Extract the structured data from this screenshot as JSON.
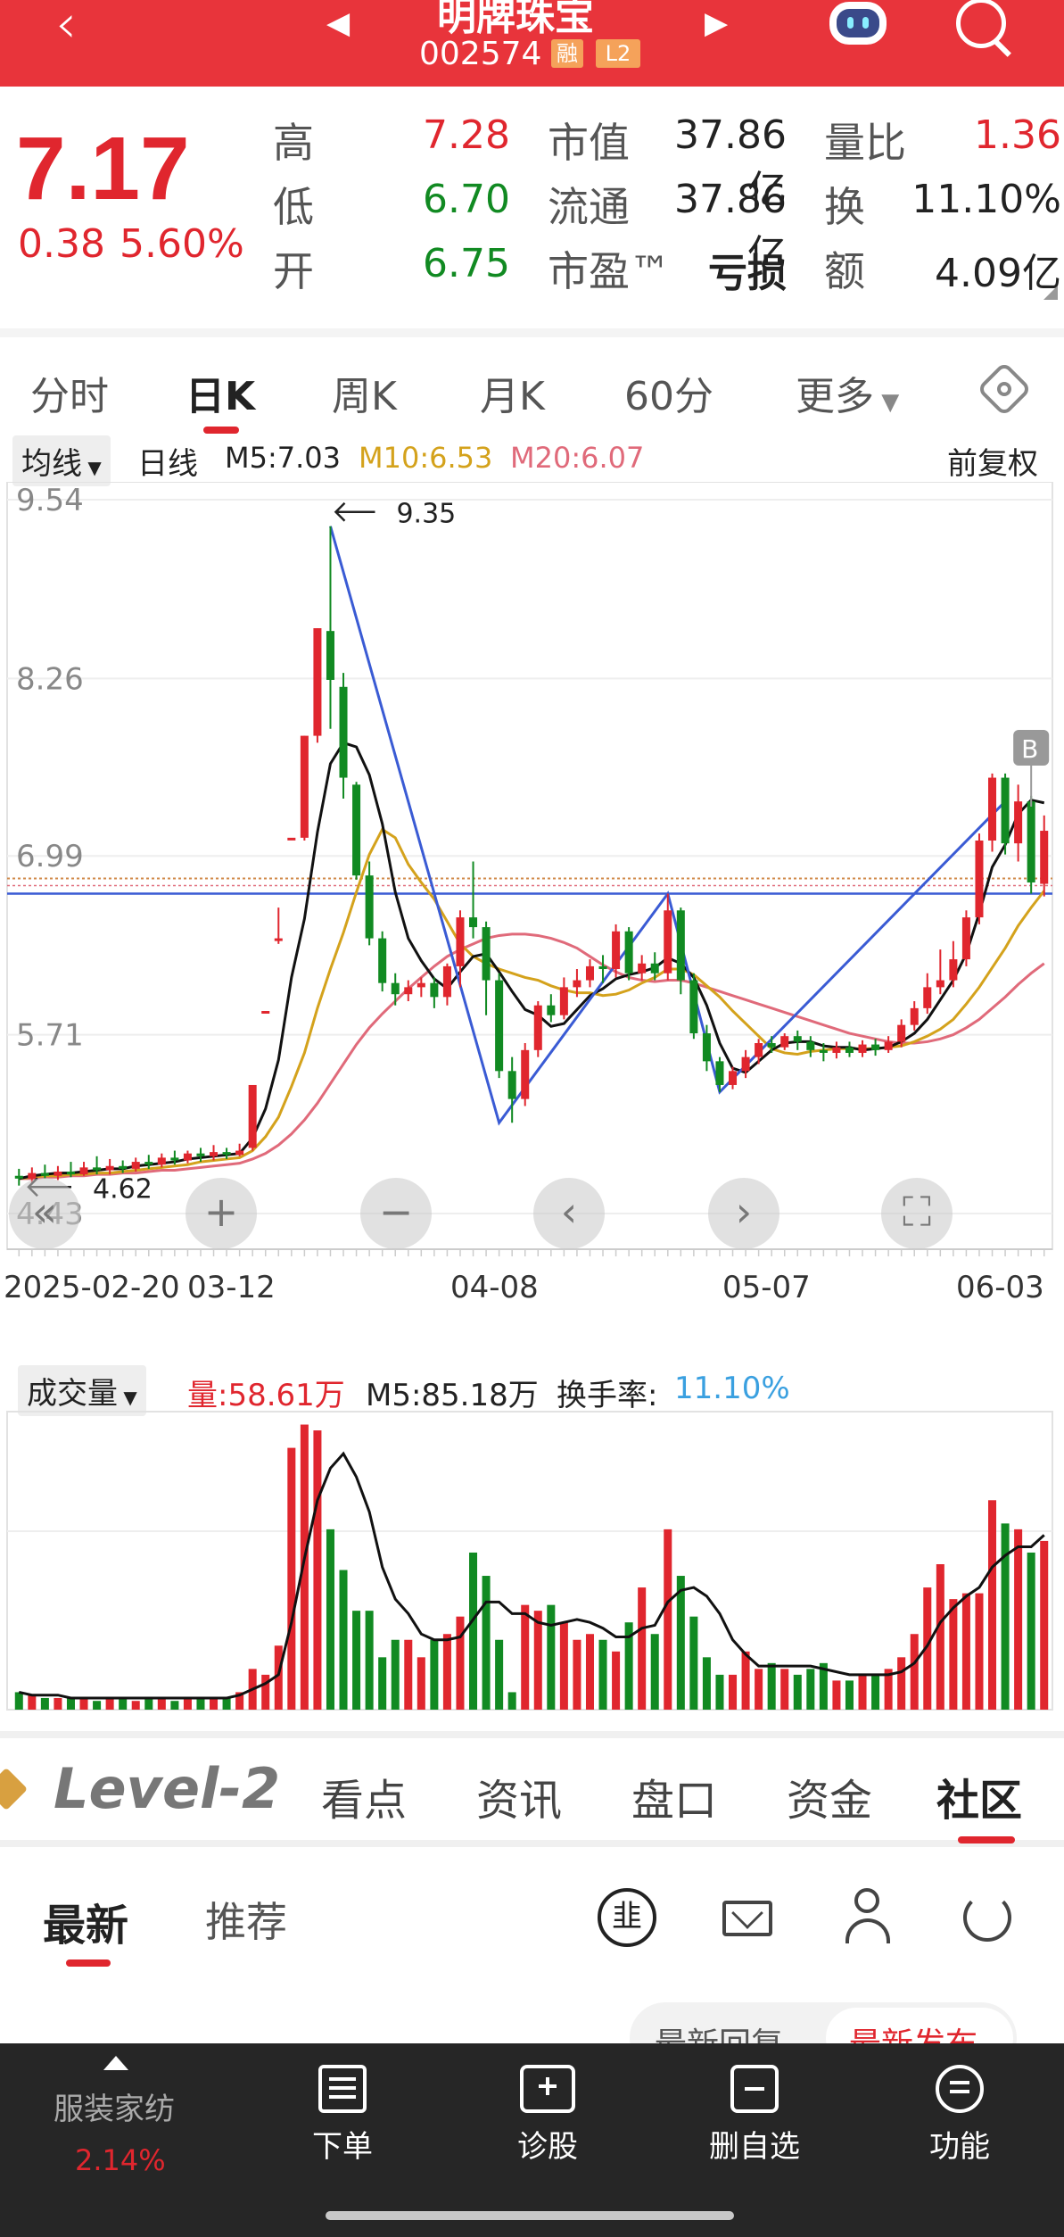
{
  "header": {
    "stock_name": "明牌珠宝",
    "stock_code": "002574",
    "badge_margin": "融",
    "badge_level": "L2"
  },
  "quote": {
    "price": "7.17",
    "change": "0.38",
    "change_pct": "5.60%",
    "rows": [
      {
        "l1": "高",
        "v1": "7.28",
        "l2": "市值",
        "v2": "37.86亿",
        "l3": "量比",
        "v3": "1.36"
      },
      {
        "l1": "低",
        "v1": "6.70",
        "l2": "流通",
        "v2": "37.86亿",
        "l3": "换",
        "v3": "11.10%"
      },
      {
        "l1": "开",
        "v1": "6.75",
        "l2": "市盈™",
        "v2": "亏损",
        "l3": "额",
        "v3": "4.09亿"
      }
    ]
  },
  "tabs": [
    "分时",
    "日K",
    "周K",
    "月K",
    "60分",
    "更多"
  ],
  "ma_legend": {
    "selector": "均线",
    "period": "日线",
    "m5": "M5:7.03",
    "m10": "M10:6.53",
    "m20": "M20:6.07",
    "adjust": "前复权"
  },
  "colors": {
    "up": "#e0262e",
    "down": "#118a22",
    "m5": "#111111",
    "m10": "#d4a21c",
    "m20": "#e06a7a",
    "trend": "#3a5bd4"
  },
  "chart_data": {
    "type": "candlestick",
    "y_ticks": [
      "9.54",
      "8.26",
      "6.99",
      "5.71",
      "4.43"
    ],
    "ylim": [
      4.43,
      9.54
    ],
    "x_ticks": [
      "2025-02-20",
      "03-12",
      "04-08",
      "05-07",
      "06-03"
    ],
    "max_label": "9.35",
    "min_label": "4.62",
    "b_marker": "B",
    "candles": [
      [
        4.7,
        4.68,
        4.75,
        4.63
      ],
      [
        4.68,
        4.72,
        4.76,
        4.65
      ],
      [
        4.72,
        4.7,
        4.78,
        4.68
      ],
      [
        4.7,
        4.73,
        4.77,
        4.67
      ],
      [
        4.73,
        4.71,
        4.8,
        4.69
      ],
      [
        4.71,
        4.76,
        4.8,
        4.7
      ],
      [
        4.76,
        4.74,
        4.84,
        4.71
      ],
      [
        4.74,
        4.77,
        4.82,
        4.71
      ],
      [
        4.77,
        4.75,
        4.81,
        4.72
      ],
      [
        4.75,
        4.8,
        4.83,
        4.73
      ],
      [
        4.8,
        4.78,
        4.85,
        4.75
      ],
      [
        4.78,
        4.83,
        4.86,
        4.76
      ],
      [
        4.83,
        4.81,
        4.88,
        4.78
      ],
      [
        4.81,
        4.86,
        4.88,
        4.79
      ],
      [
        4.86,
        4.84,
        4.9,
        4.8
      ],
      [
        4.84,
        4.87,
        4.92,
        4.81
      ],
      [
        4.87,
        4.85,
        4.9,
        4.82
      ],
      [
        4.85,
        4.88,
        4.93,
        4.84
      ],
      [
        4.9,
        5.35,
        5.35,
        4.88
      ],
      [
        5.88,
        5.88,
        5.88,
        5.88
      ],
      [
        6.4,
        6.4,
        6.62,
        6.36
      ],
      [
        7.12,
        7.12,
        7.12,
        7.12
      ],
      [
        7.12,
        7.85,
        7.85,
        7.1
      ],
      [
        7.85,
        8.62,
        8.62,
        7.8
      ],
      [
        8.6,
        8.25,
        9.35,
        7.9
      ],
      [
        8.2,
        7.55,
        8.3,
        7.4
      ],
      [
        7.5,
        6.85,
        7.52,
        6.82
      ],
      [
        6.85,
        6.4,
        6.95,
        6.35
      ],
      [
        6.4,
        6.08,
        6.45,
        6.02
      ],
      [
        6.08,
        6.0,
        6.15,
        5.92
      ],
      [
        6.0,
        6.05,
        6.1,
        5.95
      ],
      [
        6.05,
        6.08,
        6.12,
        5.98
      ],
      [
        6.08,
        5.98,
        6.12,
        5.9
      ],
      [
        5.98,
        6.2,
        6.22,
        5.92
      ],
      [
        6.2,
        6.55,
        6.6,
        6.05
      ],
      [
        6.55,
        6.48,
        6.95,
        6.4
      ],
      [
        6.48,
        6.1,
        6.52,
        5.85
      ],
      [
        6.1,
        5.45,
        6.15,
        5.4
      ],
      [
        5.45,
        5.25,
        5.55,
        5.08
      ],
      [
        5.25,
        5.6,
        5.65,
        5.2
      ],
      [
        5.6,
        5.92,
        5.95,
        5.55
      ],
      [
        5.92,
        5.85,
        6.0,
        5.8
      ],
      [
        5.85,
        6.05,
        6.12,
        5.82
      ],
      [
        6.05,
        6.1,
        6.18,
        5.98
      ],
      [
        6.1,
        6.2,
        6.25,
        6.05
      ],
      [
        6.2,
        6.18,
        6.28,
        6.08
      ],
      [
        6.18,
        6.45,
        6.5,
        6.12
      ],
      [
        6.45,
        6.15,
        6.48,
        6.1
      ],
      [
        6.15,
        6.22,
        6.28,
        6.1
      ],
      [
        6.22,
        6.15,
        6.3,
        6.1
      ],
      [
        6.15,
        6.6,
        6.72,
        6.1
      ],
      [
        6.6,
        6.1,
        6.62,
        6.0
      ],
      [
        6.1,
        5.72,
        6.15,
        5.68
      ],
      [
        5.72,
        5.52,
        5.78,
        5.45
      ],
      [
        5.52,
        5.35,
        5.55,
        5.3
      ],
      [
        5.35,
        5.45,
        5.48,
        5.32
      ],
      [
        5.45,
        5.55,
        5.6,
        5.4
      ],
      [
        5.55,
        5.65,
        5.68,
        5.5
      ],
      [
        5.65,
        5.62,
        5.7,
        5.58
      ],
      [
        5.62,
        5.7,
        5.72,
        5.6
      ],
      [
        5.7,
        5.66,
        5.74,
        5.6
      ],
      [
        5.66,
        5.6,
        5.7,
        5.55
      ],
      [
        5.6,
        5.58,
        5.65,
        5.52
      ],
      [
        5.58,
        5.62,
        5.66,
        5.54
      ],
      [
        5.62,
        5.58,
        5.66,
        5.55
      ],
      [
        5.58,
        5.64,
        5.67,
        5.55
      ],
      [
        5.64,
        5.6,
        5.68,
        5.56
      ],
      [
        5.6,
        5.66,
        5.7,
        5.58
      ],
      [
        5.66,
        5.78,
        5.82,
        5.62
      ],
      [
        5.78,
        5.9,
        5.95,
        5.74
      ],
      [
        5.9,
        6.05,
        6.15,
        5.86
      ],
      [
        6.05,
        6.1,
        6.32,
        6.0
      ],
      [
        6.1,
        6.25,
        6.38,
        6.05
      ],
      [
        6.25,
        6.55,
        6.6,
        6.2
      ],
      [
        6.55,
        7.1,
        7.15,
        6.5
      ],
      [
        7.1,
        7.55,
        7.58,
        7.02
      ],
      [
        7.55,
        7.08,
        7.58,
        7.0
      ],
      [
        7.08,
        7.38,
        7.5,
        6.95
      ],
      [
        7.38,
        6.8,
        7.42,
        6.72
      ],
      [
        6.79,
        7.17,
        7.28,
        6.7
      ]
    ],
    "m5": [
      4.68,
      4.7,
      4.71,
      4.72,
      4.72,
      4.73,
      4.74,
      4.75,
      4.75,
      4.77,
      4.78,
      4.79,
      4.8,
      4.82,
      4.83,
      4.84,
      4.85,
      4.86,
      4.97,
      5.18,
      5.53,
      6.12,
      6.54,
      7.16,
      7.65,
      7.8,
      7.77,
      7.57,
      7.22,
      6.73,
      6.4,
      6.24,
      6.11,
      6.04,
      6.16,
      6.27,
      6.29,
      6.16,
      6.02,
      5.89,
      5.85,
      5.77,
      5.79,
      5.89,
      5.99,
      6.04,
      6.11,
      6.14,
      6.16,
      6.19,
      6.26,
      6.22,
      6.12,
      5.92,
      5.65,
      5.47,
      5.44,
      5.52,
      5.6,
      5.65,
      5.66,
      5.66,
      5.63,
      5.62,
      5.62,
      5.6,
      5.61,
      5.62,
      5.66,
      5.72,
      5.82,
      5.96,
      6.1,
      6.29,
      6.58,
      6.91,
      7.07,
      7.29,
      7.39,
      7.37
    ],
    "m10": [
      4.68,
      4.69,
      4.7,
      4.7,
      4.71,
      4.71,
      4.72,
      4.72,
      4.73,
      4.74,
      4.75,
      4.76,
      4.77,
      4.78,
      4.8,
      4.81,
      4.82,
      4.83,
      4.88,
      4.98,
      5.12,
      5.34,
      5.58,
      5.9,
      6.18,
      6.44,
      6.73,
      7.0,
      7.18,
      7.12,
      6.93,
      6.8,
      6.68,
      6.52,
      6.36,
      6.27,
      6.22,
      6.18,
      6.15,
      6.12,
      6.1,
      6.06,
      6.03,
      6.01,
      6.01,
      5.99,
      6.0,
      6.03,
      6.08,
      6.12,
      6.18,
      6.18,
      6.14,
      6.06,
      5.98,
      5.88,
      5.79,
      5.7,
      5.61,
      5.58,
      5.57,
      5.59,
      5.6,
      5.61,
      5.61,
      5.61,
      5.61,
      5.62,
      5.63,
      5.66,
      5.7,
      5.75,
      5.82,
      5.93,
      6.05,
      6.19,
      6.33,
      6.49,
      6.62,
      6.74
    ],
    "m20": [
      4.68,
      4.68,
      4.69,
      4.69,
      4.7,
      4.7,
      4.71,
      4.71,
      4.72,
      4.72,
      4.73,
      4.74,
      4.74,
      4.75,
      4.76,
      4.77,
      4.78,
      4.79,
      4.82,
      4.86,
      4.92,
      5.0,
      5.1,
      5.22,
      5.36,
      5.5,
      5.64,
      5.76,
      5.86,
      5.95,
      6.04,
      6.12,
      6.2,
      6.27,
      6.32,
      6.36,
      6.4,
      6.42,
      6.43,
      6.43,
      6.42,
      6.4,
      6.37,
      6.33,
      6.27,
      6.21,
      6.16,
      6.12,
      6.1,
      6.09,
      6.1,
      6.1,
      6.08,
      6.05,
      6.02,
      5.99,
      5.96,
      5.93,
      5.9,
      5.87,
      5.84,
      5.81,
      5.78,
      5.75,
      5.72,
      5.7,
      5.68,
      5.66,
      5.65,
      5.65,
      5.66,
      5.68,
      5.71,
      5.76,
      5.82,
      5.9,
      5.98,
      6.07,
      6.15,
      6.22
    ],
    "trend_points": [
      [
        24,
        9.35
      ],
      [
        37,
        5.08
      ],
      [
        50,
        6.72
      ],
      [
        54,
        5.3
      ],
      [
        76,
        7.38
      ]
    ],
    "ref_line": 6.72,
    "prev_close_line": 6.79
  },
  "volume": {
    "selector": "成交量",
    "vol_label": "量:58.61万",
    "m5_label": "M5:85.18万",
    "turnover_label": "换手率:",
    "turnover_value": "11.10%",
    "bars": [
      6,
      5,
      4,
      4,
      4,
      4,
      3,
      4,
      4,
      3,
      4,
      4,
      3,
      4,
      4,
      4,
      4,
      6,
      14,
      12,
      22,
      90,
      98,
      96,
      62,
      48,
      34,
      34,
      18,
      24,
      24,
      18,
      24,
      26,
      32,
      54,
      46,
      24,
      6,
      36,
      34,
      36,
      30,
      24,
      26,
      24,
      20,
      30,
      42,
      26,
      62,
      46,
      32,
      18,
      12,
      12,
      20,
      14,
      16,
      14,
      12,
      14,
      16,
      10,
      10,
      12,
      12,
      14,
      18,
      26,
      42,
      50,
      38,
      40,
      40,
      72,
      64,
      62,
      54,
      58
    ],
    "up": [
      0,
      1,
      0,
      1,
      0,
      1,
      0,
      1,
      0,
      1,
      0,
      1,
      0,
      1,
      0,
      1,
      0,
      1,
      1,
      1,
      1,
      1,
      1,
      1,
      0,
      0,
      0,
      0,
      0,
      0,
      1,
      1,
      0,
      1,
      1,
      0,
      0,
      0,
      0,
      1,
      1,
      0,
      1,
      1,
      1,
      0,
      1,
      0,
      1,
      0,
      1,
      0,
      0,
      0,
      0,
      1,
      1,
      1,
      0,
      1,
      0,
      0,
      0,
      1,
      0,
      1,
      0,
      1,
      1,
      1,
      1,
      1,
      1,
      1,
      1,
      1,
      0,
      1,
      0,
      1
    ],
    "ma": [
      6,
      5,
      5,
      5,
      4,
      4,
      4,
      4,
      4,
      4,
      4,
      4,
      4,
      4,
      4,
      4,
      4,
      5,
      7,
      9,
      12,
      30,
      52,
      72,
      83,
      88,
      80,
      68,
      49,
      38,
      33,
      26,
      24,
      24,
      25,
      31,
      37,
      37,
      33,
      33,
      30,
      29,
      30,
      31,
      30,
      28,
      25,
      25,
      28,
      29,
      37,
      41,
      42,
      39,
      33,
      24,
      19,
      15,
      15,
      15,
      15,
      15,
      14,
      13,
      12,
      12,
      12,
      12,
      13,
      16,
      22,
      30,
      35,
      39,
      42,
      49,
      53,
      56,
      56,
      60
    ]
  },
  "bottom_tabs": {
    "brand": "Level-2",
    "items": [
      "看点",
      "资讯",
      "盘口",
      "资金",
      "社区"
    ]
  },
  "sub_tabs": {
    "latest": "最新",
    "recommend": "推荐",
    "pill_reply": "最新回复",
    "pill_post": "最新发布"
  },
  "navbar": {
    "sector_name": "服装家纺",
    "sector_change": "2.14%",
    "items": [
      "下单",
      "诊股",
      "删自选",
      "功能"
    ]
  }
}
